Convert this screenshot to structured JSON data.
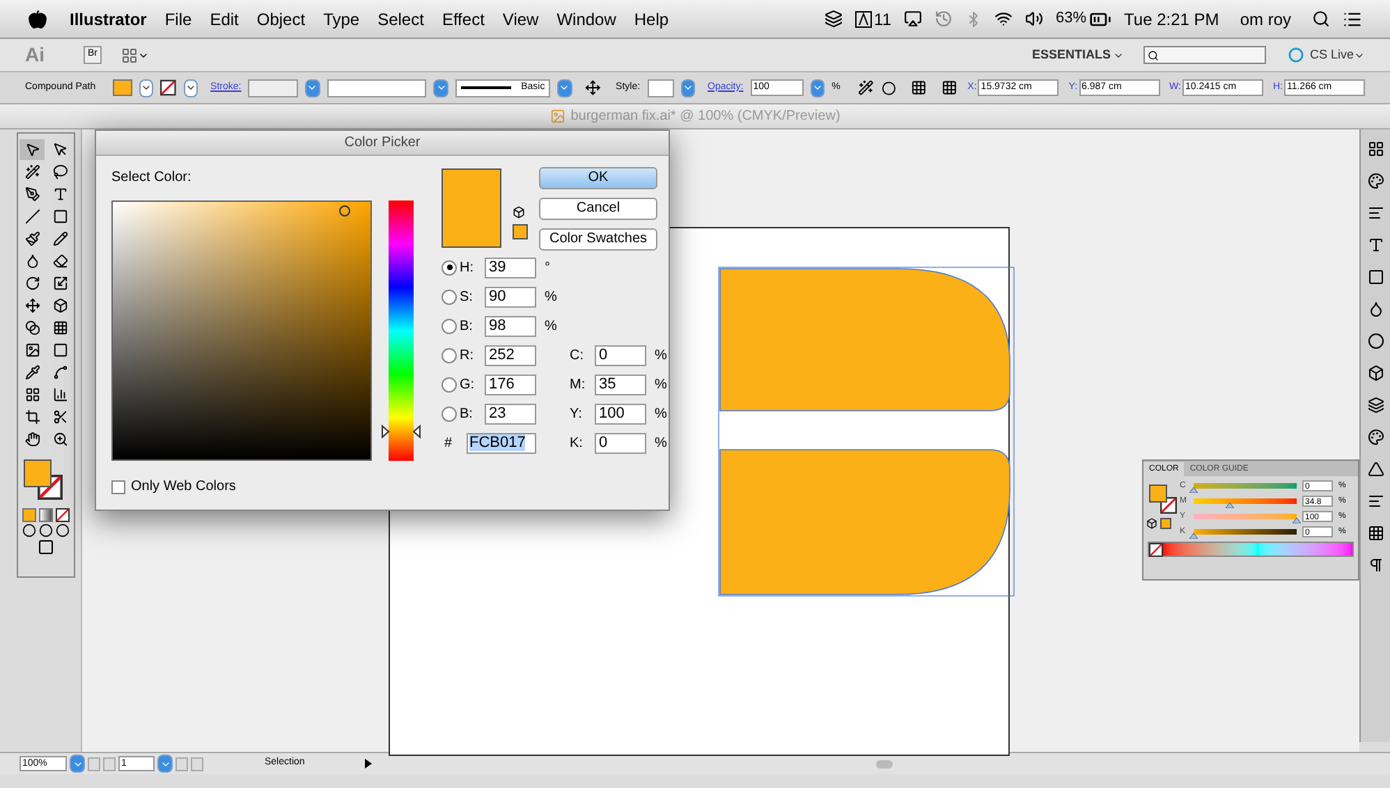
{
  "menubar": {
    "app": "Illustrator",
    "menus": [
      "File",
      "Edit",
      "Object",
      "Type",
      "Select",
      "Effect",
      "View",
      "Window",
      "Help"
    ],
    "adobe_count": "11",
    "battery": "63%",
    "clock": "Tue 2:21 PM",
    "user": "om roy"
  },
  "appbar": {
    "logo": "Ai",
    "bridge": "Br",
    "workspace": "ESSENTIALS",
    "cs_live": "CS Live"
  },
  "control_bar": {
    "selection_type": "Compound Path",
    "stroke_label": "Stroke:",
    "brush": "Basic",
    "style_label": "Style:",
    "opacity_label": "Opacity:",
    "opacity": "100",
    "opacity_unit": "%",
    "transform": [
      {
        "label": "X:",
        "value": "15.9732 cm"
      },
      {
        "label": "Y:",
        "value": "6.987 cm"
      },
      {
        "label": "W:",
        "value": "10.2415 cm"
      },
      {
        "label": "H:",
        "value": "11.266 cm"
      }
    ]
  },
  "document": {
    "title": "burgerman fix.ai* @ 100% (CMYK/Preview)"
  },
  "color_picker": {
    "title": "Color Picker",
    "prompt": "Select Color:",
    "hue_slider": {
      "level": 0.11
    },
    "buttons": [
      "OK",
      "Cancel",
      "Color Swatches"
    ],
    "hsb": [
      {
        "label": "H:",
        "value": "39",
        "unit": "°",
        "selected": true
      },
      {
        "label": "S:",
        "value": "90",
        "unit": "%",
        "selected": false
      },
      {
        "label": "B:",
        "value": "98",
        "unit": "%",
        "selected": false
      }
    ],
    "rgb": [
      {
        "label": "R:",
        "value": "252",
        "selected": false
      },
      {
        "label": "G:",
        "value": "176",
        "selected": false
      },
      {
        "label": "B:",
        "value": "23",
        "selected": false
      }
    ],
    "cmyk": [
      {
        "label": "C:",
        "value": "0",
        "unit": "%"
      },
      {
        "label": "M:",
        "value": "35",
        "unit": "%"
      },
      {
        "label": "Y:",
        "value": "100",
        "unit": "%"
      },
      {
        "label": "K:",
        "value": "0",
        "unit": "%"
      }
    ],
    "hex_label": "#",
    "hex": "FCB017",
    "web_colors": {
      "label": "Only Web Colors",
      "checked": false
    }
  },
  "color_panel": {
    "tabs": [
      {
        "label": "COLOR",
        "selected": true
      },
      {
        "label": "COLOR GUIDE",
        "selected": false
      }
    ],
    "channels": [
      {
        "label": "C",
        "value": "0",
        "unit": "%",
        "level": 0
      },
      {
        "label": "M",
        "value": "34.8",
        "unit": "%",
        "level": 0.348
      },
      {
        "label": "Y",
        "value": "100",
        "unit": "%",
        "level": 1
      },
      {
        "label": "K",
        "value": "0",
        "unit": "%",
        "level": 0
      }
    ]
  },
  "status_bar": {
    "zoom": "100%",
    "page": "1",
    "tool": "Selection"
  }
}
